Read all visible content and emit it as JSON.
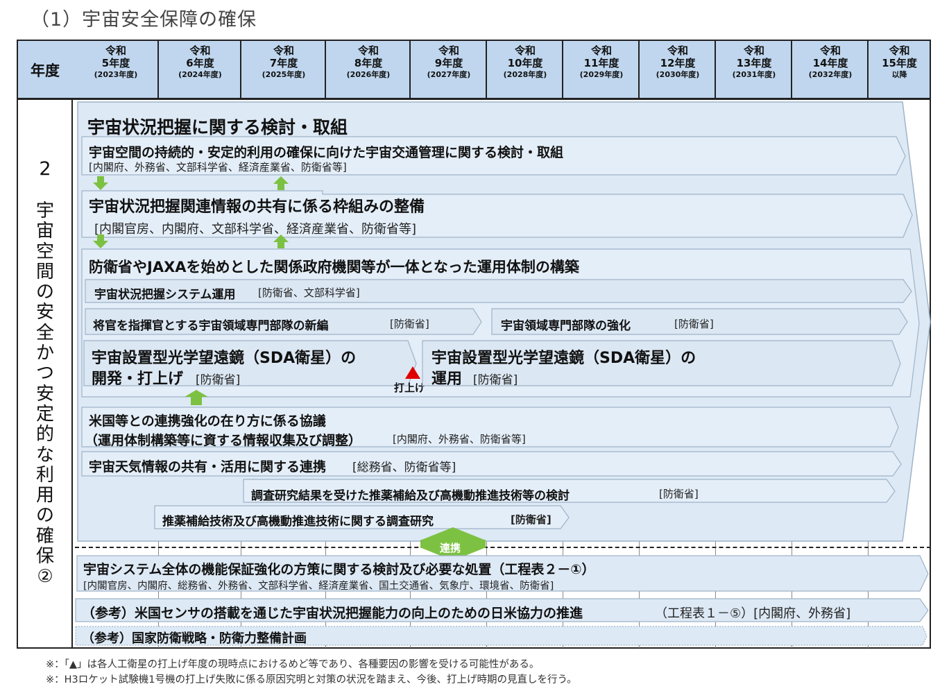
{
  "section_title": "（1）宇宙安全保障の確保",
  "header": {
    "year_label": "年度",
    "years": [
      {
        "l1": "令和",
        "l2": "5年度",
        "l3": "(2023年度)"
      },
      {
        "l1": "令和",
        "l2": "6年度",
        "l3": "(2024年度)"
      },
      {
        "l1": "令和",
        "l2": "7年度",
        "l3": "(2025年度)"
      },
      {
        "l1": "令和",
        "l2": "8年度",
        "l3": "(2026年度)"
      },
      {
        "l1": "令和",
        "l2": "9年度",
        "l3": "(2027年度)"
      },
      {
        "l1": "令和",
        "l2": "10年度",
        "l3": "(2028年度)"
      },
      {
        "l1": "令和",
        "l2": "11年度",
        "l3": "(2029年度)"
      },
      {
        "l1": "令和",
        "l2": "12年度",
        "l3": "(2030年度)"
      },
      {
        "l1": "令和",
        "l2": "13年度",
        "l3": "(2031年度)"
      },
      {
        "l1": "令和",
        "l2": "14年度",
        "l3": "(2032年度)"
      },
      {
        "l1": "令和",
        "l2": "15年度",
        "l3": "以降"
      }
    ]
  },
  "category": {
    "number": "2",
    "text": "宇宙空間の安全かつ安定的な利用の確保②"
  },
  "items": {
    "main_title": "宇宙状況把握に関する検討・取組",
    "traffic_title": "宇宙空間の持続的・安定的利用の確保に向けた宇宙交通管理に関する検討・取組",
    "traffic_orgs": "[内閣府、外務省、文部科学省、経済産業省、防衛省等]",
    "framework_title": "宇宙状況把握関連情報の共有に係る枠組みの整備",
    "framework_orgs": "[内閣官房、内閣府、文部科学省、経済産業省、防衛省等]",
    "ops_title": "防衛省やJAXAを始めとした関係政府機関等が一体となった運用体制の構築",
    "ssa_system_title": "宇宙状況把握システム運用",
    "ssa_system_orgs": "[防衛省、文部科学省]",
    "unit_new_title": "将官を指揮官とする宇宙領域専門部隊の新編",
    "unit_new_orgs": "[防衛省]",
    "unit_strengthen_title": "宇宙領域専門部隊の強化",
    "unit_strengthen_orgs": "[防衛省]",
    "sda_dev_line1": "宇宙設置型光学望遠鏡（SDA衛星）の",
    "sda_dev_line2": "開発・打上げ",
    "sda_dev_orgs": "[防衛省]",
    "launch_label": "打上げ",
    "sda_ops_line1": "宇宙設置型光学望遠鏡（SDA衛星）の",
    "sda_ops_line2": "運用",
    "sda_ops_orgs": "[防衛省]",
    "us_line1": "米国等との連携強化の在り方に係る協議",
    "us_line2": "（運用体制構築等に資する情報収集及び調整）",
    "us_orgs": "[内閣府、外務省、防衛省等]",
    "weather_title": "宇宙天気情報の共有・活用に関する連携",
    "weather_orgs": "[総務省、防衛省等]",
    "propulsion_study_title": "調査研究結果を受けた推薬補給及び高機動推進技術等の検討",
    "propulsion_study_orgs": "[防衛省]",
    "propulsion_research_title": "推薬補給技術及び高機動推進技術に関する調査研究",
    "propulsion_research_orgs": "[防衛省]",
    "link_label": "連携",
    "mission_title": "宇宙システム全体の機能保証強化の方策に関する検討及び必要な処置（工程表２－①）",
    "mission_orgs": "[内閣官房、内閣府、総務省、外務省、文部科学省、経済産業省、国土交通省、気象庁、環境省、防衛省]",
    "ref_sensor_title": "（参考）米国センサの搭載を通じた宇宙状況把握能力の向上のための日米協力の推進",
    "ref_sensor_orgs": "（工程表１－⑤）[内閣府、外務省]",
    "ref_defense_title": "（参考）国家防衛戦略・防衛力整備計画"
  },
  "notes": [
    "※：「▲」は各人工衛星の打上げ年度の現時点におけるめど等であり、各種要因の影響を受ける可能性がある。",
    "※：H3ロケット試験機1号機の打上げ失敗に係る原因究明と対策の状況を踏まえ、今後、打上げ時期の見直しを行う。"
  ],
  "colors": {
    "header_fill": "#bfd6ee",
    "bar_fill": "#dde9f5",
    "bar_stroke": "#9fb3c8",
    "arrow_green": "#7dc142",
    "launch_marker": "#e00000"
  }
}
